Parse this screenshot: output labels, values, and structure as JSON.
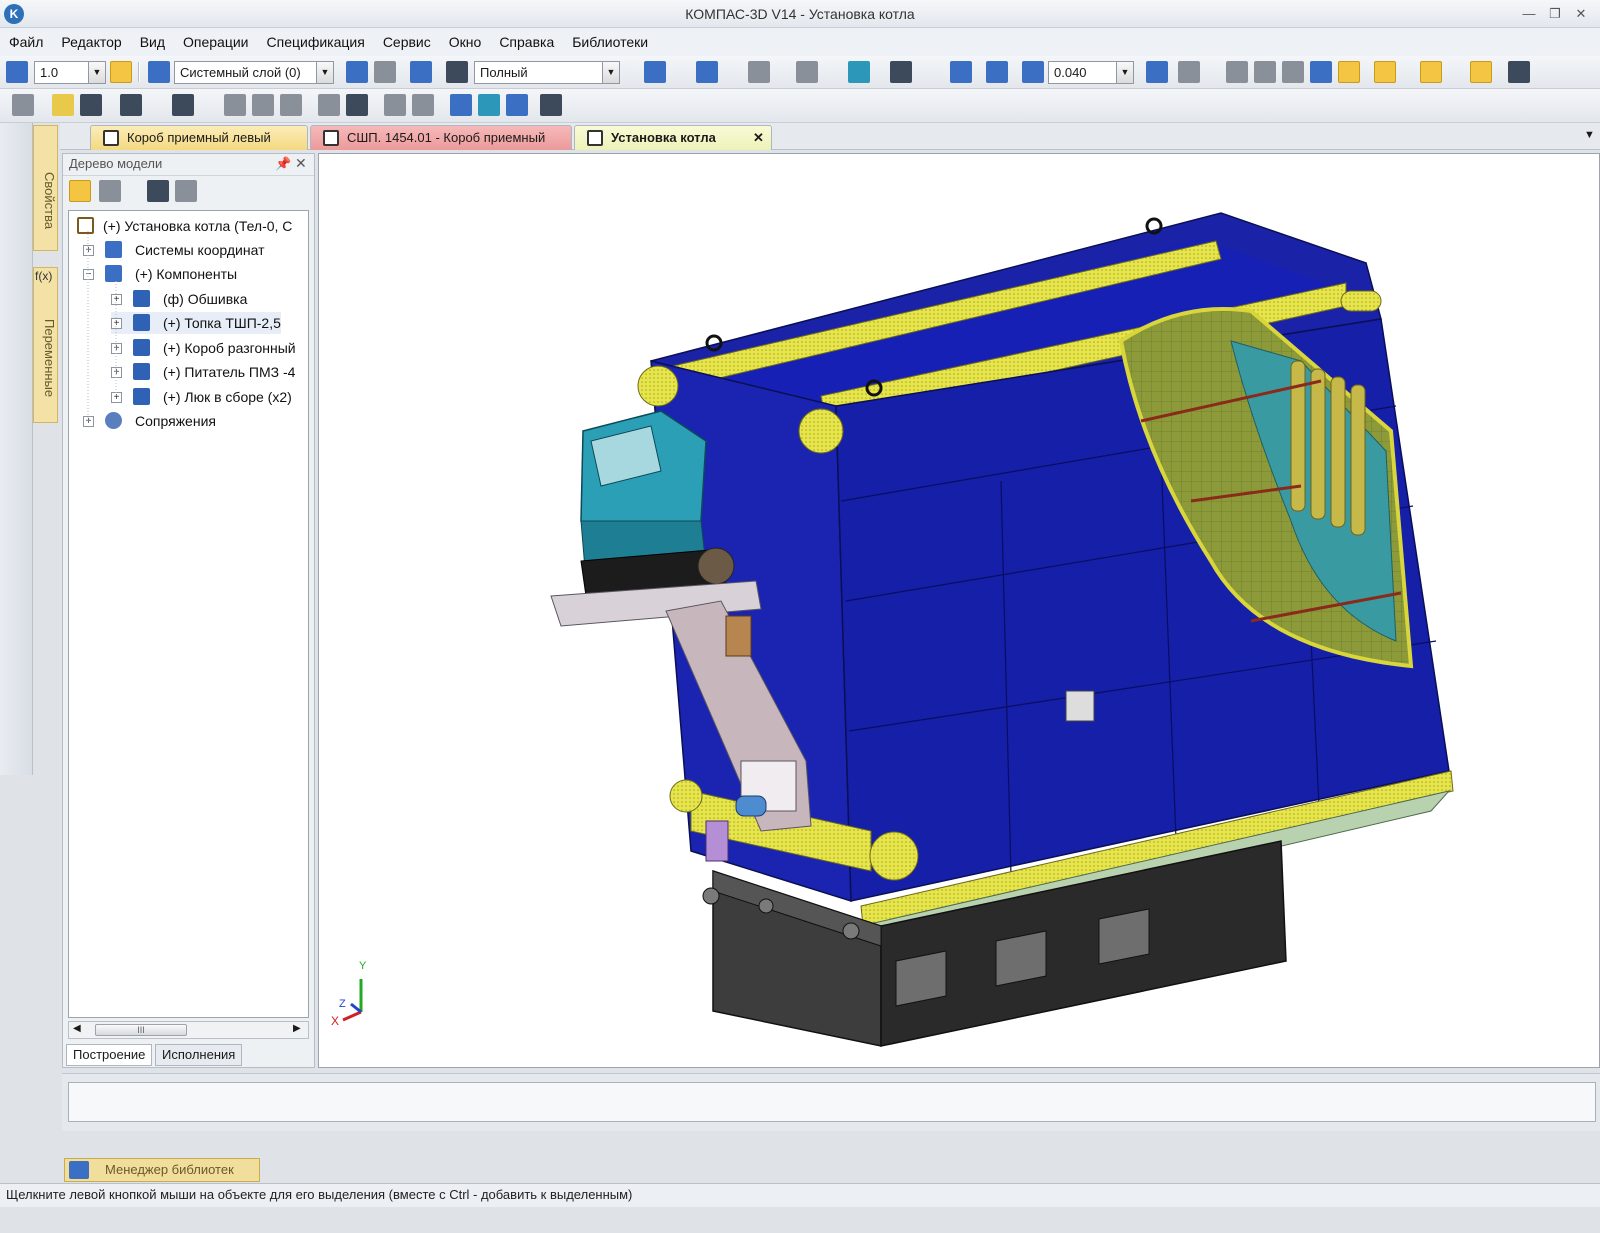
{
  "window": {
    "title": "КОМПАС-3D V14 - Установка котла",
    "app_icon": "K"
  },
  "menu": [
    "Файл",
    "Редактор",
    "Вид",
    "Операции",
    "Спецификация",
    "Сервис",
    "Окно",
    "Справка",
    "Библиотеки"
  ],
  "toolbar1": {
    "step_value": "1.0",
    "layer_value": "Системный слой (0)",
    "mode_value": "Полный",
    "zoom_value": "0.040"
  },
  "side_tabs": {
    "properties": "Свойства",
    "variables": "Переменные",
    "fx": "f(x)"
  },
  "doc_tabs": [
    {
      "label": "Короб приемный левый"
    },
    {
      "label": "СШП. 1454.01 - Короб приемный"
    },
    {
      "label": "Установка котла",
      "close": "✕"
    }
  ],
  "tree": {
    "header": "Дерево модели",
    "nodes": [
      {
        "label": "(+) Установка котла (Тел-0, С"
      },
      {
        "label": "Системы координат"
      },
      {
        "label": "(+) Компоненты"
      },
      {
        "label": "(ф) Обшивка"
      },
      {
        "label": "(+) Топка ТШП-2,5"
      },
      {
        "label": "(+) Короб разгонный"
      },
      {
        "label": "(+) Питатель ПМЗ -4"
      },
      {
        "label": "(+) Люк в сборе (x2)"
      },
      {
        "label": "Сопряжения"
      }
    ],
    "tabs": [
      "Построение",
      "Исполнения"
    ],
    "scroll_thumb": "III"
  },
  "axes": {
    "x": "X",
    "y": "Y",
    "z": "Z"
  },
  "library_manager": "Менеджер библиотек",
  "status": "Щелкните левой кнопкой мыши на объекте для его выделения (вместе с Ctrl - добавить к выделенным)",
  "colors": {
    "boiler_blue": "#1a23a8",
    "pipe_yellow": "#e8e64a",
    "feeder_cyan": "#2a9fb6",
    "firebox_dark": "#3c3c3c"
  }
}
